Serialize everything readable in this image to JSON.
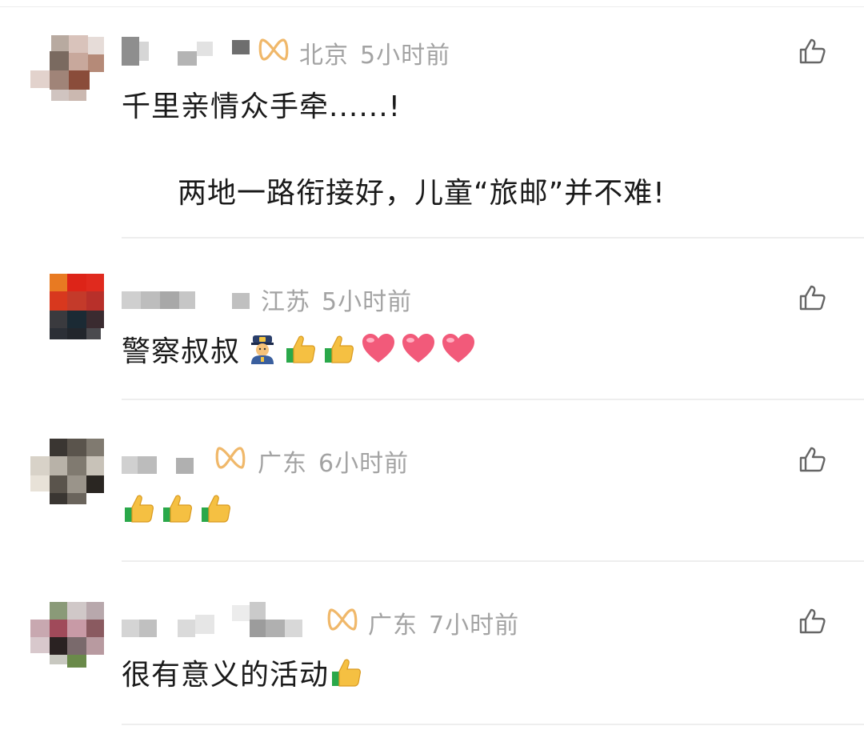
{
  "comments": [
    {
      "location": "北京",
      "time": "5小时前",
      "has_badge": true,
      "text": "千里亲情众手牵......!",
      "text_line2": "两地一路衔接好，儿童“旅邮”并不难!",
      "emojis": [],
      "avatar_palette": [
        "#7a6a60",
        "#c8a89c",
        "#e2d2cc",
        "#8a4c3a",
        "#b58a78",
        "#d9c3bb"
      ]
    },
    {
      "location": "江苏",
      "time": "5小时前",
      "has_badge": false,
      "text": "警察叔叔",
      "emojis": [
        "police-officer-emoji",
        "thumbs-up-emoji",
        "thumbs-up-emoji",
        "heart-emoji",
        "heart-emoji",
        "heart-emoji"
      ],
      "avatar_palette": [
        "#e87a22",
        "#dd2418",
        "#c43a2a",
        "#2b2f36",
        "#1b2a34",
        "#3a2b30"
      ]
    },
    {
      "location": "广东",
      "time": "6小时前",
      "has_badge": true,
      "text": "",
      "emojis": [
        "thumbs-up-emoji",
        "thumbs-up-emoji",
        "thumbs-up-emoji"
      ],
      "avatar_palette": [
        "#3a3632",
        "#807a70",
        "#b8b2a8",
        "#5a544c",
        "#d8d2c8",
        "#2a2622"
      ]
    },
    {
      "location": "广东",
      "time": "7小时前",
      "has_badge": true,
      "text": "很有意义的活动",
      "emojis": [
        "thumbs-up-emoji"
      ],
      "avatar_palette": [
        "#8a9a78",
        "#a04a5a",
        "#c89aa6",
        "#2a2222",
        "#6a8a4a",
        "#d8c8cc"
      ]
    }
  ],
  "colors": {
    "badge": "#f0b86a",
    "meta_text": "#a3a3a3",
    "body_text": "#1a1a1a",
    "like_icon": "#666666"
  }
}
